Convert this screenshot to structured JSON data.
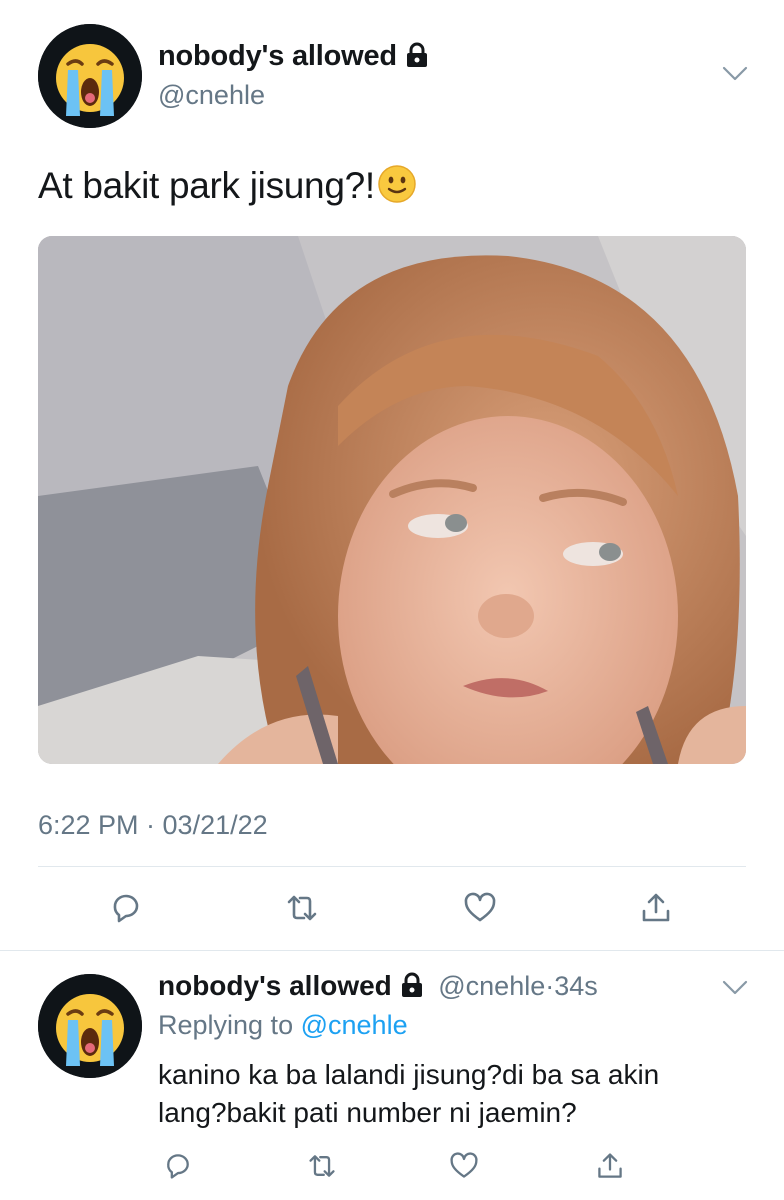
{
  "tweet": {
    "display_name": "nobody's allowed",
    "handle": "@cnehle",
    "text": "At bakit park jisung?!",
    "emoji": "🙂",
    "avatar_icon": "loudly-crying-face-icon",
    "timestamp": "6:22 PM · 03/21/22"
  },
  "actions": [
    "reply-icon",
    "retweet-icon",
    "like-icon",
    "share-icon"
  ],
  "reply": {
    "display_name": "nobody's allowed",
    "handle": "@cnehle",
    "separator": "·",
    "age": "34s",
    "replying_prefix": "Replying to",
    "replying_handle": "@cnehle",
    "text": "kanino ka ba lalandi jisung?di ba sa akin lang?bakit pati number ni jaemin?"
  },
  "colors": {
    "text": "#14171a",
    "secondary": "#657786",
    "link": "#1da1f2",
    "divider": "#e1e8ed"
  }
}
